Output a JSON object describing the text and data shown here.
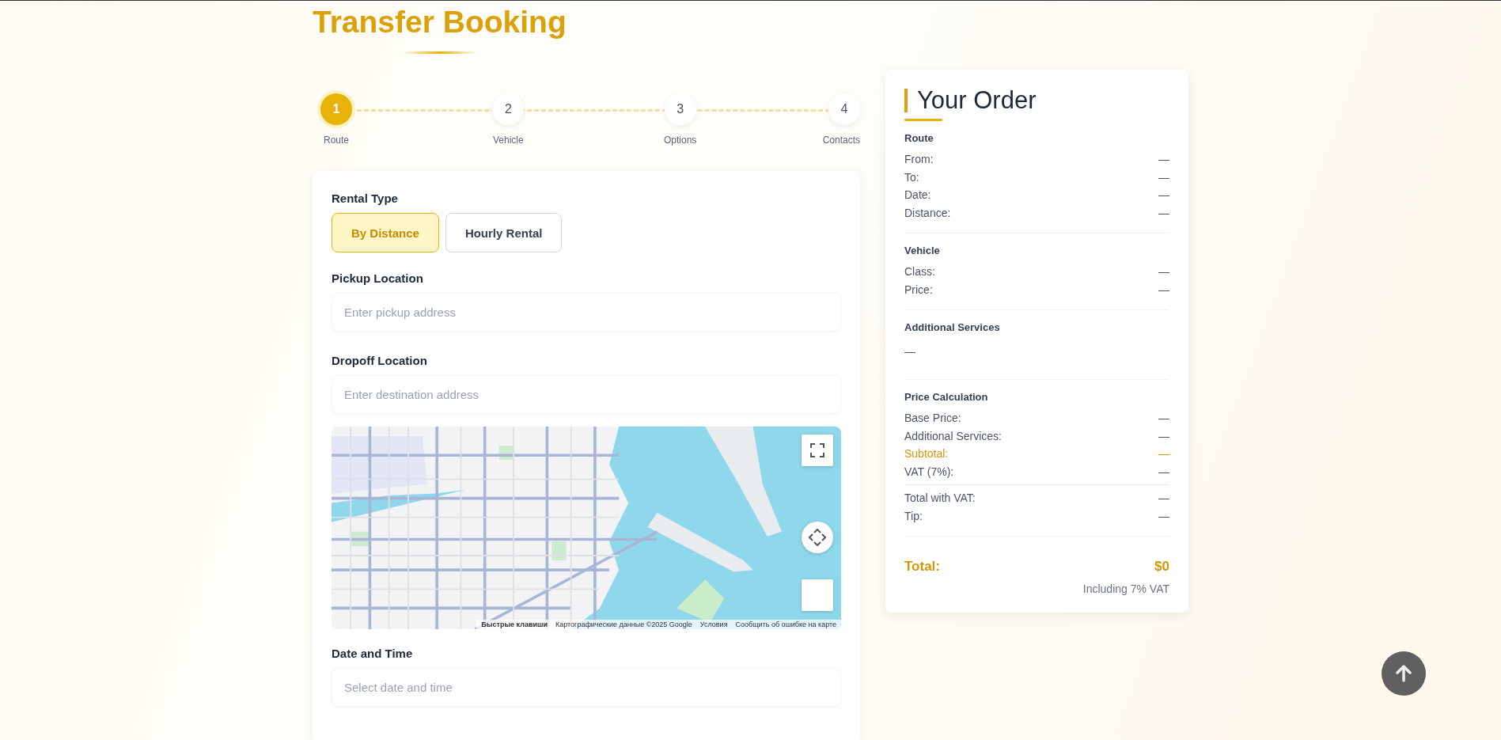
{
  "page_title": "Transfer Booking",
  "steps": [
    {
      "number": "1",
      "label": "Route",
      "selected": true
    },
    {
      "number": "2",
      "label": "Vehicle",
      "selected": false
    },
    {
      "number": "3",
      "label": "Options",
      "selected": false
    },
    {
      "number": "4",
      "label": "Contacts",
      "selected": false
    }
  ],
  "form": {
    "rental_type": {
      "label": "Rental Type",
      "options": [
        {
          "label": "By Distance",
          "selected": true
        },
        {
          "label": "Hourly Rental",
          "selected": false
        }
      ]
    },
    "pickup": {
      "label": "Pickup Location",
      "placeholder": "Enter pickup address"
    },
    "dropoff": {
      "label": "Dropoff Location",
      "placeholder": "Enter destination address"
    },
    "map": {
      "kind": "picture",
      "attribution": [
        "Быстрые клавиши",
        "Картографические данные ©2025 Google",
        "Условия",
        "Сообщить об ошибке на карте"
      ]
    },
    "datetime": {
      "label": "Date and Time",
      "placeholder": "Select date and time"
    }
  },
  "order": {
    "title": "Your Order",
    "sections": [
      {
        "heading": "Route",
        "rows": [
          {
            "label": "From:",
            "value": "—",
            "kind": "plain"
          },
          {
            "label": "To:",
            "value": "—",
            "kind": "plain"
          },
          {
            "label": "Date:",
            "value": "—",
            "kind": "plain"
          },
          {
            "label": "Distance:",
            "value": "—",
            "kind": "plain"
          }
        ]
      },
      {
        "heading": "Vehicle",
        "rows": [
          {
            "label": "Class:",
            "value": "—",
            "kind": "plain"
          },
          {
            "label": "Price:",
            "value": "—",
            "kind": "plain"
          }
        ]
      },
      {
        "heading": "Additional Services",
        "empty": "—"
      },
      {
        "heading": "Price Calculation",
        "rows": [
          {
            "label": "Base Price:",
            "value": "—",
            "kind": "plain"
          },
          {
            "label": "Additional Services:",
            "value": "—",
            "kind": "plain"
          },
          {
            "label": "Subtotal:",
            "value": "—",
            "kind": "accent"
          },
          {
            "label": "VAT (7%):",
            "value": "—",
            "kind": "plain"
          },
          {
            "label": "Total with VAT:",
            "value": "—",
            "kind": "ruled"
          },
          {
            "label": "Tip:",
            "value": "—",
            "kind": "plain"
          }
        ]
      }
    ],
    "total": {
      "label": "Total:",
      "value": "$0",
      "note": "Including 7% VAT"
    }
  }
}
